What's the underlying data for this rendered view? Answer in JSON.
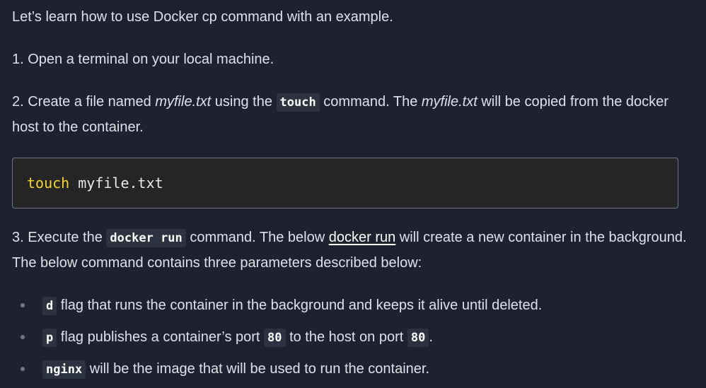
{
  "intro": "Let’s learn how to use Docker cp command with an example.",
  "step1": "1. Open a terminal on your local machine.",
  "step2": {
    "prefix": "2. Create a file named ",
    "file1": "myfile.txt",
    "mid1": " using the ",
    "cmd": "touch",
    "mid2": " command. The ",
    "file2": "myfile.txt",
    "suffix": " will be copied from the docker host to the container."
  },
  "code_block": {
    "keyword": "touch",
    "args": " myfile.txt"
  },
  "step3": {
    "prefix": "3. Execute the ",
    "cmd": "docker run",
    "mid": " command. The below ",
    "link": "docker run",
    "suffix": " will create a new container in the background. The below command contains three parameters described below:"
  },
  "params": [
    {
      "code": "d",
      "text": " flag that runs the container in the background and keeps it alive until deleted."
    },
    {
      "code": "p",
      "text1": " flag publishes a container’s port ",
      "code2": "80",
      "text2": " to the host on port ",
      "code3": "80",
      "text3": "."
    },
    {
      "code": "nginx",
      "text": " will be the image that will be used to run the container."
    }
  ],
  "colors": {
    "background": "#1e2230",
    "text": "#dde1ea",
    "code_block_bg": "#252526",
    "code_keyword": "#f4d52f",
    "inline_code_bg": "#2d3240"
  }
}
